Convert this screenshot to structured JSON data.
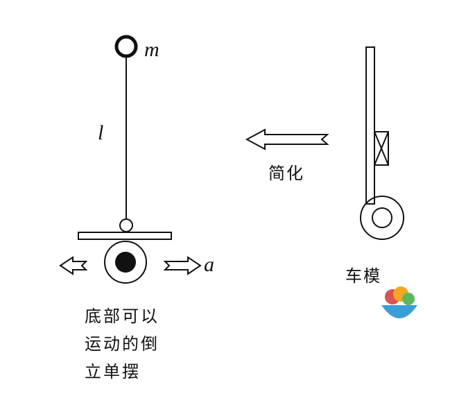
{
  "labels": {
    "mass": "m",
    "length": "l",
    "acceleration": "a",
    "simplify": "简化",
    "car_model": "车模",
    "caption_lines": [
      "底部可以",
      "运动的倒",
      "立单摆"
    ]
  },
  "colors": {
    "stroke": "#111111",
    "background": "#ffffff",
    "emoji_orange": "#f5a623",
    "emoji_red": "#d9534f",
    "emoji_green": "#5cb85c",
    "emoji_bowl": "#3a9fd6"
  }
}
